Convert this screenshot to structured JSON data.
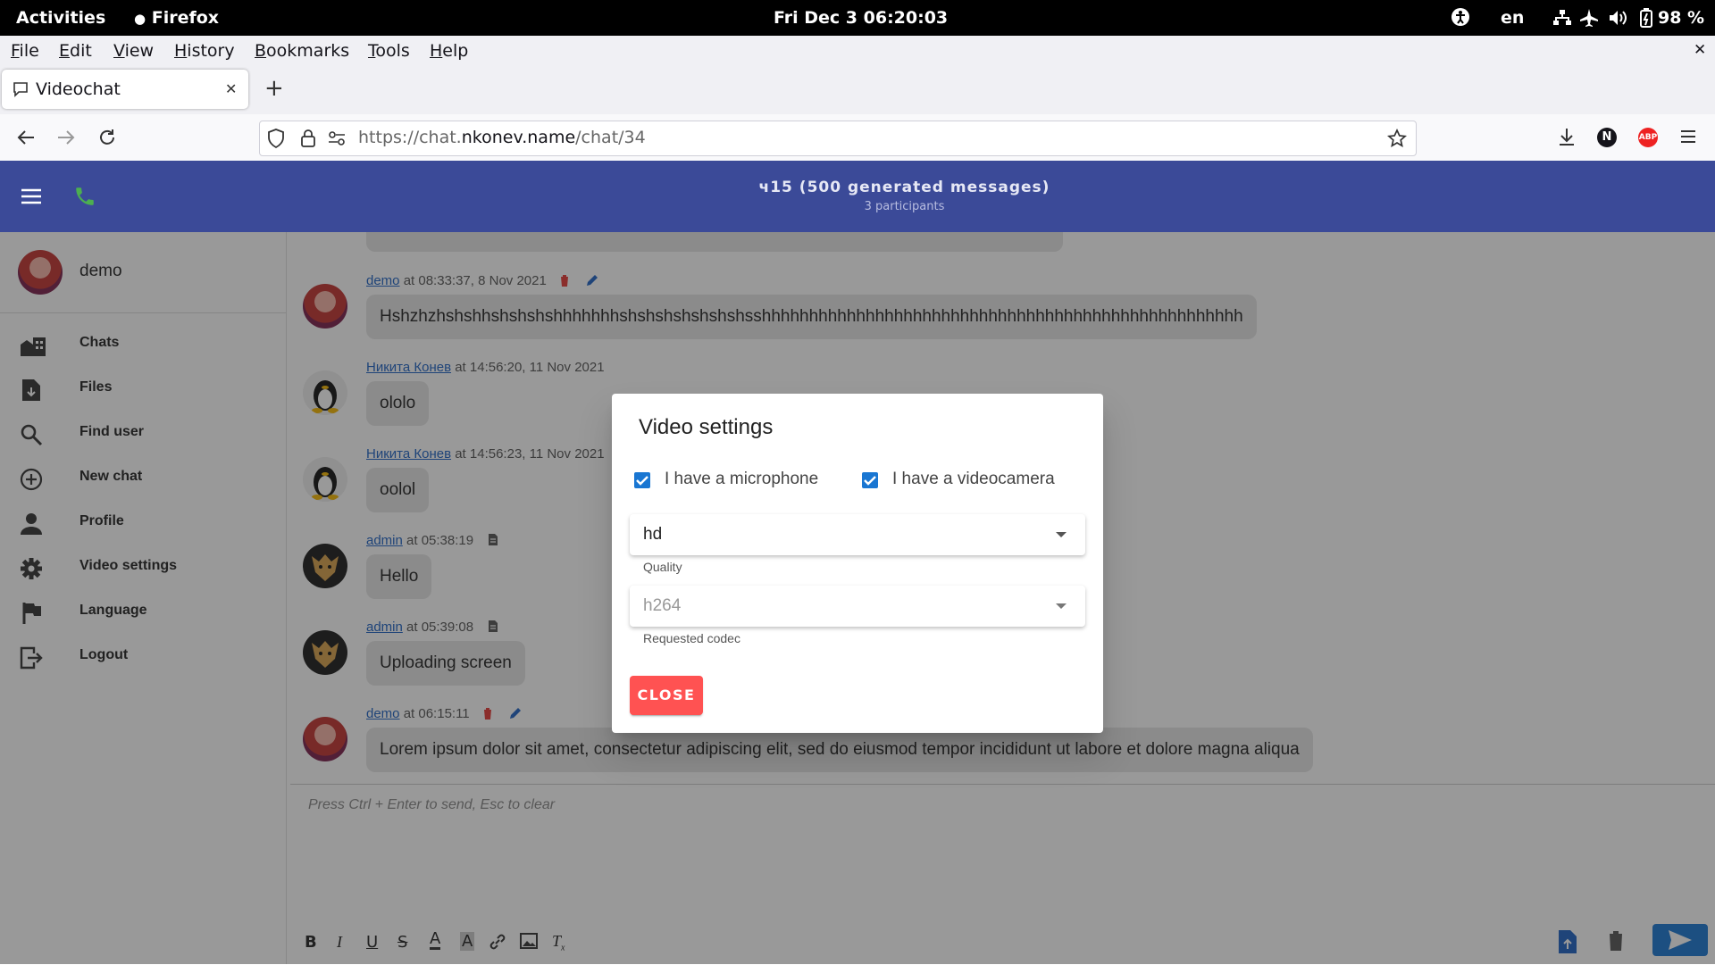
{
  "system_bar": {
    "activities": "Activities",
    "app_name": "Firefox",
    "clock": "Fri Dec 3  06:20:03",
    "language": "en",
    "battery": "98 %"
  },
  "menubar": {
    "items": [
      {
        "label": "File",
        "mnemonic": "F",
        "rest": "ile"
      },
      {
        "label": "Edit",
        "mnemonic": "E",
        "rest": "dit"
      },
      {
        "label": "View",
        "mnemonic": "V",
        "rest": "iew"
      },
      {
        "label": "History",
        "mnemonic": "H",
        "rest": "istory"
      },
      {
        "label": "Bookmarks",
        "mnemonic": "B",
        "rest": "ookmarks"
      },
      {
        "label": "Tools",
        "mnemonic": "T",
        "rest": "ools"
      },
      {
        "label": "Help",
        "mnemonic": "H",
        "rest": "elp"
      }
    ]
  },
  "browser": {
    "tab_title": "Videochat",
    "url_scheme": "https://chat.",
    "url_host": "nkonev.name",
    "url_path": "/chat/34"
  },
  "appbar": {
    "chat_title": "ч15 (500 generated messages)",
    "participants": "3 participants"
  },
  "sidebar": {
    "user_name": "demo",
    "items": [
      {
        "label": "Chats",
        "icon": "chats-icon"
      },
      {
        "label": "Files",
        "icon": "file-icon"
      },
      {
        "label": "Find user",
        "icon": "search-icon"
      },
      {
        "label": "New chat",
        "icon": "plus-circle-icon"
      },
      {
        "label": "Profile",
        "icon": "person-icon"
      },
      {
        "label": "Video settings",
        "icon": "gear-icon"
      },
      {
        "label": "Language",
        "icon": "flag-icon"
      },
      {
        "label": "Logout",
        "icon": "logout-icon"
      }
    ]
  },
  "messages": [
    {
      "author": "demo",
      "meta": " at 08:33:37, 8 Nov 2021",
      "text": "Hshzhzhshshhshshshshhhhhhhshshshshshshshsshhhhhhhhhhhhhhhhhhhhhhhhhhhhhhhhhhhhhhhhhhhhhhhhhhh"
    },
    {
      "author": "Никита Конев",
      "meta": " at 14:56:20, 11 Nov 2021",
      "text": "ololo"
    },
    {
      "author": "Никита Конев",
      "meta": " at 14:56:23, 11 Nov 2021",
      "text": "oolol"
    },
    {
      "author": "admin",
      "meta": " at 05:38:19",
      "text": "Hello"
    },
    {
      "author": "admin",
      "meta": " at 05:39:08",
      "text": "Uploading screen"
    },
    {
      "author": "demo",
      "meta": " at 06:15:11",
      "text": "Lorem ipsum dolor sit amet, consectetur adipiscing elit, sed do eiusmod tempor incididunt ut labore et dolore magna aliqua"
    }
  ],
  "composer": {
    "placeholder": "Press Ctrl + Enter to send, Esc to clear"
  },
  "dialog": {
    "title": "Video settings",
    "microphone_label": "I have a microphone",
    "microphone_checked": true,
    "camera_label": "I have a videocamera",
    "camera_checked": true,
    "quality_value": "hd",
    "quality_hint": "Quality",
    "codec_value": "h264",
    "codec_hint": "Requested codec",
    "close_label": "CLOSE"
  },
  "colors": {
    "appbar": "#3b4a98",
    "link": "#1e63c4",
    "close_button": "#ff5252",
    "checkbox": "#1976d2",
    "send_button": "#1976d2"
  }
}
